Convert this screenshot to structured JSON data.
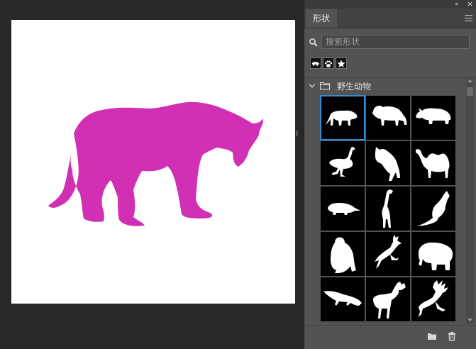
{
  "panel": {
    "collapse_glyph": "«",
    "close_glyph": "×",
    "tab_label": "形状",
    "menu_icon": "hamburger-menu-icon"
  },
  "search": {
    "placeholder": "搜索形状",
    "value": "",
    "icon": "magnifier-icon"
  },
  "recent_shapes": [
    {
      "name": "boar-shape-icon"
    },
    {
      "name": "paw-shape-icon"
    },
    {
      "name": "star-shape-icon"
    }
  ],
  "group": {
    "label": "野生动物",
    "expanded": true,
    "icon": "folder-icon"
  },
  "shapes": [
    {
      "name": "tiger",
      "selected": true
    },
    {
      "name": "lion",
      "selected": false
    },
    {
      "name": "rhinoceros",
      "selected": false
    },
    {
      "name": "ostrich",
      "selected": false
    },
    {
      "name": "wolf",
      "selected": false
    },
    {
      "name": "camel",
      "selected": false
    },
    {
      "name": "rodent",
      "selected": false
    },
    {
      "name": "giraffe",
      "selected": false
    },
    {
      "name": "kangaroo",
      "selected": false
    },
    {
      "name": "orangutan",
      "selected": false
    },
    {
      "name": "leaping-deer",
      "selected": false
    },
    {
      "name": "elephant",
      "selected": false
    },
    {
      "name": "lizard",
      "selected": false
    },
    {
      "name": "moose",
      "selected": false
    },
    {
      "name": "reindeer",
      "selected": false
    }
  ],
  "footer": {
    "new_group_icon": "new-folder-icon",
    "delete_icon": "trash-icon"
  },
  "colors": {
    "shape_fill": "#d12fb4",
    "selection": "#2f8fd8",
    "panel_bg": "#535353",
    "canvas_bg": "#282828"
  }
}
